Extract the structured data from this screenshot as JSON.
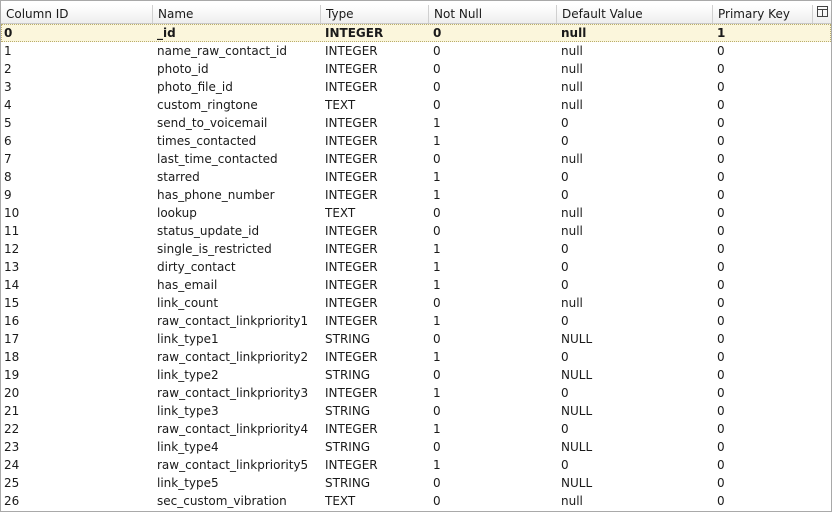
{
  "table": {
    "columns": [
      "Column ID",
      "Name",
      "Type",
      "Not Null",
      "Default Value",
      "Primary Key"
    ],
    "menu_icon": "column-chooser-icon",
    "rows": [
      [
        "0",
        "_id",
        "INTEGER",
        "0",
        "null",
        "1"
      ],
      [
        "1",
        "name_raw_contact_id",
        "INTEGER",
        "0",
        "null",
        "0"
      ],
      [
        "2",
        "photo_id",
        "INTEGER",
        "0",
        "null",
        "0"
      ],
      [
        "3",
        "photo_file_id",
        "INTEGER",
        "0",
        "null",
        "0"
      ],
      [
        "4",
        "custom_ringtone",
        "TEXT",
        "0",
        "null",
        "0"
      ],
      [
        "5",
        "send_to_voicemail",
        "INTEGER",
        "1",
        "0",
        "0"
      ],
      [
        "6",
        "times_contacted",
        "INTEGER",
        "1",
        "0",
        "0"
      ],
      [
        "7",
        "last_time_contacted",
        "INTEGER",
        "0",
        "null",
        "0"
      ],
      [
        "8",
        "starred",
        "INTEGER",
        "1",
        "0",
        "0"
      ],
      [
        "9",
        "has_phone_number",
        "INTEGER",
        "1",
        "0",
        "0"
      ],
      [
        "10",
        "lookup",
        "TEXT",
        "0",
        "null",
        "0"
      ],
      [
        "11",
        "status_update_id",
        "INTEGER",
        "0",
        "null",
        "0"
      ],
      [
        "12",
        "single_is_restricted",
        "INTEGER",
        "1",
        "0",
        "0"
      ],
      [
        "13",
        "dirty_contact",
        "INTEGER",
        "1",
        "0",
        "0"
      ],
      [
        "14",
        "has_email",
        "INTEGER",
        "1",
        "0",
        "0"
      ],
      [
        "15",
        "link_count",
        "INTEGER",
        "0",
        "null",
        "0"
      ],
      [
        "16",
        "raw_contact_linkpriority1",
        "INTEGER",
        "1",
        "0",
        "0"
      ],
      [
        "17",
        "link_type1",
        "STRING",
        "0",
        "NULL",
        "0"
      ],
      [
        "18",
        "raw_contact_linkpriority2",
        "INTEGER",
        "1",
        "0",
        "0"
      ],
      [
        "19",
        "link_type2",
        "STRING",
        "0",
        "NULL",
        "0"
      ],
      [
        "20",
        "raw_contact_linkpriority3",
        "INTEGER",
        "1",
        "0",
        "0"
      ],
      [
        "21",
        "link_type3",
        "STRING",
        "0",
        "NULL",
        "0"
      ],
      [
        "22",
        "raw_contact_linkpriority4",
        "INTEGER",
        "1",
        "0",
        "0"
      ],
      [
        "23",
        "link_type4",
        "STRING",
        "0",
        "NULL",
        "0"
      ],
      [
        "24",
        "raw_contact_linkpriority5",
        "INTEGER",
        "1",
        "0",
        "0"
      ],
      [
        "25",
        "link_type5",
        "STRING",
        "0",
        "NULL",
        "0"
      ],
      [
        "26",
        "sec_custom_vibration",
        "TEXT",
        "0",
        "null",
        "0"
      ]
    ]
  }
}
